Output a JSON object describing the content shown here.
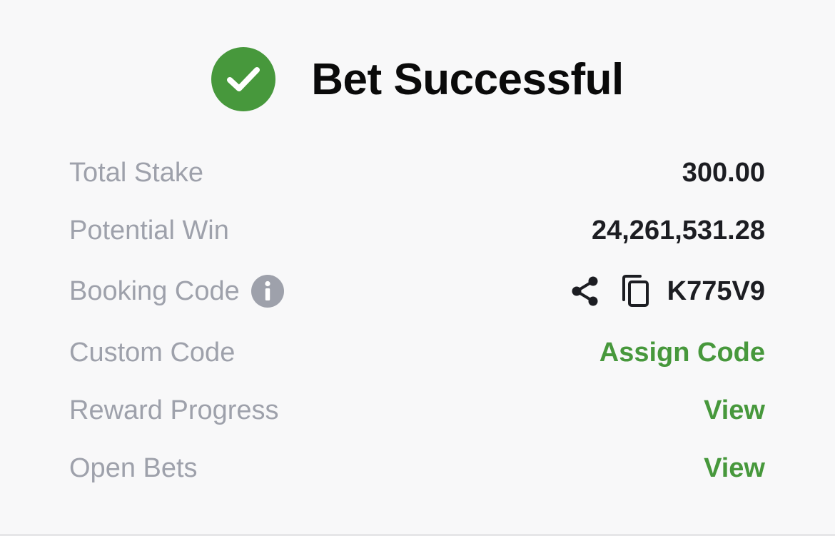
{
  "header": {
    "title": "Bet Successful",
    "icon": "check-circle-icon",
    "accent": "#47983c"
  },
  "rows": {
    "total_stake": {
      "label": "Total Stake",
      "value": "300.00"
    },
    "potential_win": {
      "label": "Potential Win",
      "value": "24,261,531.28"
    },
    "booking_code": {
      "label": "Booking Code",
      "value": "K775V9",
      "icons": [
        "info-icon",
        "share-icon",
        "copy-icon"
      ]
    },
    "custom_code": {
      "label": "Custom Code",
      "action": "Assign Code"
    },
    "reward_progress": {
      "label": "Reward Progress",
      "action": "View"
    },
    "open_bets": {
      "label": "Open Bets",
      "action": "View"
    }
  },
  "colors": {
    "label": "#9ea1ab",
    "value": "#1c1d22",
    "action": "#47983c",
    "background": "#f8f8f9"
  }
}
